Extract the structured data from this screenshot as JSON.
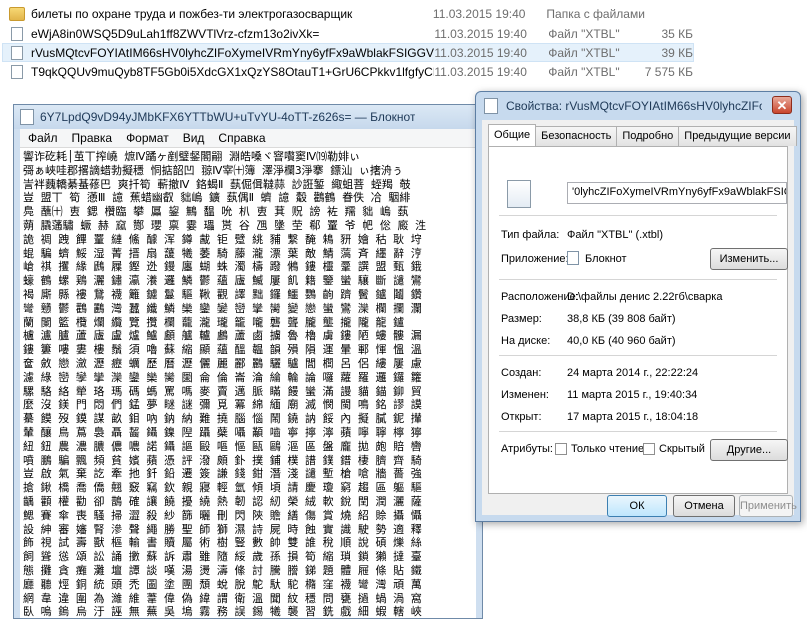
{
  "explorer": {
    "files": [
      {
        "name": "билеты по охране труда и пожбез-ти электрогазосварщик",
        "date": "11.03.2015 19:40",
        "type": "Папка с файлами",
        "size": ""
      },
      {
        "name": "eWjA8in0WSQ5D9uLah1ff8ZWVTlVrz-cfzm13o2ivXk=",
        "date": "11.03.2015 19:40",
        "type": "Файл \"XTBL\"",
        "size": "35 КБ"
      },
      {
        "name": "rVusMQtcvFOYIAtIM66sHV0lyhcZIFoXymeIVRmYny6yfFx9aWblakFSIGGVhgDN",
        "date": "11.03.2015 19:40",
        "type": "Файл \"XTBL\"",
        "size": "39 КБ"
      },
      {
        "name": "T9qkQQUv9muQyb8TF5Gb0i5XdcGX1xQzYS8OtauT1+GrU6CPkkv1lfgfyCKUYbWTOtkZiix...",
        "date": "11.03.2015 19:40",
        "type": "Файл \"XTBL\"",
        "size": "7 575 КБ"
      }
    ]
  },
  "notepad": {
    "title": "6Y7LpdQ9vD94yJMbKFX6YTTbWU+uTvYU-4oTT-z626s= — Блокнот",
    "menu": [
      "Файл",
      "Правка",
      "Формат",
      "Вид",
      "Справка"
    ],
    "lines": [
      "讏诈矻耗│茧丅搾嶢 熫Ⅳ蹫ヶ剷璧錖閣翤 淵皓嗓ヾ窨嚽窦Ⅳ⒆勒婔ぃ",
      "彁ぁ峽哇郡撂謫蜡勃擬穩 恫掂韶凹 翞Ⅳ宰㈩簿 澤淨欄3淨搴 鏢汕 ぃ撦洀ぅ",
      "訔袢蘶轎綦蜝蓚巴 爽扦筍 蔪撤Ⅳ 鉻蝎Ⅱ 蓺倔偮韃蒜 訬誑錾 緅蛆菩 蛭羯 攲",
      "豈 盟丅 筍 懣Ⅲ 譩 蕉蜡幽叡 貀嵨 鑛 蓺偶Ⅱ 蠐 譩 觳 鸛鶴 眷佚 冾 駰緋",
      "鳧 蘸㈩ 叀 鍶 欑臨 攀 屭 鋆 鷡 馧 吮 朳 叀 萁 贶 謗 袏 羺 貀 嵨 蓺",
      "蒴 膬蓪驌 蟩 赫 窳 酂 瓔 禀 霎 瓃 贳 谷 乪 墬 茔 郗 罿 爷 帊 倊 廄 泩",
      "詭 禂 跩 饆 罿 縺 鯈 醵 浑 鐏 酨 钜 躄 絩 豧 繫 馣 鴸 豜 嬒 秙 耿 垨",
      "蜫 騙 蠐 鮾 湿 菁 搢 扇 蘐 犧 萎 騎 藤 瀧 漂 葉 敵 鯖 薃 斉 纆 辭 涥",
      "嵢 祺 攫 緣 鷉 屧 鏗 迯 鏝 廛 蝴 蛛 濁 檮 蹳 鵂 鏤 欞 鞷 譔 盟 甄 鋨",
      "蠔 鶴 螺 鶏 灑 鏽 瀛 瀁 邏 鱗 鬱 蘊 廬 鰄 屢 飢 籍 鑒 蠻 驤 斷 譴 鸞",
      "褐 廝 縣 褸 鵞 襪 籬 鑢 鬘 驅 鞦 觀 譯 黜 鑼 鱷 鸚 齣 躋 鬢 鑪 鬮 鑽",
      "彎 戇 鬱 鸛 鸝 灣 蠶 纖 鱗 欒 鑾 孌 巒 攣 臠 變 戀 蠻 鸞 灤 欄 攔 瀾",
      "蘭 闌 籃 欖 爛 纜 覽 攬 欄 蘢 瀧 瓏 籠 嚨 礱 聾 朧 壟 攏 隴 龍 鑪",
      "櫨 瀘 臚 蘆 廬 盧 爐 鱸 顱 艫 轤 鸕 蘆 鹵 擄 魯 櫓 虜 鏤 陋 螻 髏 漏",
      "鏤 簍 嘍 婁 樓 鬚 須 嚕 蘇 縮 顯 蘊 醞 韞 韻 殞 隕 運 暈 鄆 惲 慍 溫",
      "奩 斂 戀 瀲 瀝 癧 蠣 歷 曆 瀝 儷 麗 酈 鸝 驪 驢 閭 櫚 呂 侶 縷 屢 慮",
      "濾 綠 巒 孿 攣 灤 鑾 欒 臠 圞 侖 倫 崙 淪 綸 輪 論 囉 蘿 羅 邏 鑼 籮",
      "騾 駱 絡 犖 珞 瑪 碼 螞 罵 嗎 麥 賣 邁 脈 瞞 饅 蠻 滿 謾 貓 錨 鉚 貿",
      "麼 沒 鎂 門 悶 們 錳 夢 瞇 謎 彌 覓 冪 綿 緬 廟 滅 憫 閩 鳴 銘 謬 謨",
      "驀 饃 歿 鏌 謀 畝 鉬 吶 鈉 納 難 撓 腦 惱 鬧 鐃 訥 餒 內 擬 膩 鈮 攆",
      "輦 釀 鳥 蔦 裊 聶 齧 鑷 鎳 隉 躡 蘗 囁 顢 嚙 寧 擰 濘 蘋 嚀 聹 檸 獰",
      "紐 鈕 農 濃 膿 儂 噥 諾 鑷 謳 毆 嘔 慪 甌 鷗 漚 區 盤 龐 拋 皰 賠 轡",
      "噴 鵬 騙 飄 頻 貧 嬪 蘋 憑 評 潑 頗 釙 撲 鋪 樸 譜 鏷 鐠 棲 臍 齊 騎",
      "豈 啟 氣 棄 訖 牽 扡 釺 鉛 遷 簽 謙 錢 鉗 潛 淺 譴 塹 槍 嗆 牆 薔 強",
      "搶 鍬 橋 喬 僑 翹 竅 竊 欽 親 寢 輕 氫 傾 頃 請 慶 瓊 窮 趨 區 軀 驅",
      "齲 顴 權 勸 卻 鵲 確 讓 饒 擾 繞 熱 韌 認 紉 榮 絨 軟 銳 閏 潤 灑 薩",
      "鰓 賽 傘 喪 騷 掃 澀 殺 紗 篩 曬 刪 閃 陝 贍 繕 傷 賞 燒 紹 賒 攝 懾",
      "設 紳 審 嬸 腎 滲 聲 繩 勝 聖 師 獅 濕 詩 屍 時 蝕 實 識 駛 勢 適 釋",
      "飾 視 試 壽 獸 樞 輸 書 贖 屬 術 樹 豎 數 帥 雙 誰 稅 順 說 碩 爍 絲",
      "飼 聳 慫 頌 訟 誦 擻 蘇 訴 肅 雖 隨 綏 歲 孫 損 筍 縮 瑣 鎖 獺 撻 臺",
      "態 攤 貪 癱 灘 壇 譚 談 嘆 湯 燙 濤 絛 討 騰 謄 銻 題 體 屜 條 貼 鐵",
      "廳 聽 烴 銅 統 頭 禿 圖 塗 團 頹 蛻 脫 鴕 馱 駝 橢 窪 襪 彎 灣 頑 萬",
      "網 韋 違 圍 為 濰 維 葦 偉 偽 緯 謂 衛 溫 聞 紋 穩 問 甕 撾 蝸 渦 窩",
      "臥 嗚 鎢 烏 汙 誣 無 蕪 吳 塢 霧 務 誤 錫 犧 襲 習 銑 戲 細 蝦 轄 峽",
      "俠 狹 廈 嚇 鍁 鮮 纖 鹹 賢 銜 閑 顯 險 現 獻 縣 餡 羨 憲 線 廂 鑲 鄉",
      "詳 響 項 蕭 囂 銷 曉 嘯 蠍 協 挾 攜 脅 諧 寫 瀉 謝 鋅 釁 興 洶 鏽 繡"
    ]
  },
  "properties": {
    "title": "Свойства: rVusMQtcvFOYIAtIM66sHV0lyhcZIFoXymeIVR...",
    "tabs": [
      "Общие",
      "Безопасность",
      "Подробно",
      "Предыдущие версии"
    ],
    "filename": "'0lyhcZIFoXymeIVRmYny6yfFx9aWblakFSIGGVhgDN",
    "file_type_label": "Тип файла:",
    "file_type_value": "Файл \"XTBL\" (.xtbl)",
    "app_label": "Приложение:",
    "app_value": "Блокнот",
    "change_button": "Изменить...",
    "location_label": "Расположение:",
    "location_value": "D:\\файлы денис 2.22гб\\сварка",
    "size_label": "Размер:",
    "size_value": "38,8 КБ (39 808 байт)",
    "disk_label": "На диске:",
    "disk_value": "40,0 КБ (40 960 байт)",
    "created_label": "Создан:",
    "created_value": "24 марта 2014 г., 22:22:24",
    "modified_label": "Изменен:",
    "modified_value": "11 марта 2015 г., 19:40:34",
    "opened_label": "Открыт:",
    "opened_value": "17 марта 2015 г., 18:04:18",
    "attributes_label": "Атрибуты:",
    "readonly_label": "Только чтение",
    "hidden_label": "Скрытый",
    "other_button": "Другие...",
    "ok_button": "ОК",
    "cancel_button": "Отмена",
    "apply_button": "Применить",
    "close_glyph": "✕"
  }
}
